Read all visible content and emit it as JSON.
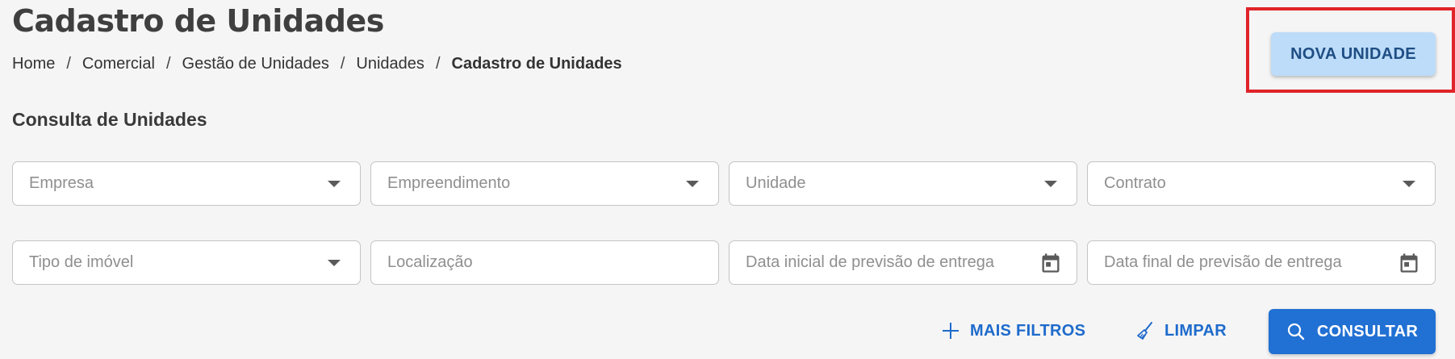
{
  "header": {
    "title": "Cadastro de Unidades",
    "new_button": "NOVA UNIDADE"
  },
  "breadcrumb": {
    "separator": "/",
    "items": [
      "Home",
      "Comercial",
      "Gestão de Unidades",
      "Unidades",
      "Cadastro de Unidades"
    ]
  },
  "filters": {
    "section_title": "Consulta de Unidades",
    "empresa": "Empresa",
    "empreendimento": "Empreendimento",
    "unidade": "Unidade",
    "contrato": "Contrato",
    "tipo_imovel": "Tipo de imóvel",
    "localizacao": "Localização",
    "data_inicial": "Data inicial de previsão de entrega",
    "data_final": "Data final de previsão de entrega"
  },
  "actions": {
    "more_filters": "MAIS FILTROS",
    "clear": "LIMPAR",
    "search": "CONSULTAR"
  },
  "icons": {
    "dropdown": "caret-down-icon",
    "date": "calendar-icon",
    "more_filters": "plus-icon",
    "clear": "broom-icon",
    "search": "search-icon"
  },
  "colors": {
    "primary": "#2170d3",
    "new_button_bg": "#bcdcf9",
    "highlight": "#e0242a",
    "background": "#f5f5f5"
  }
}
